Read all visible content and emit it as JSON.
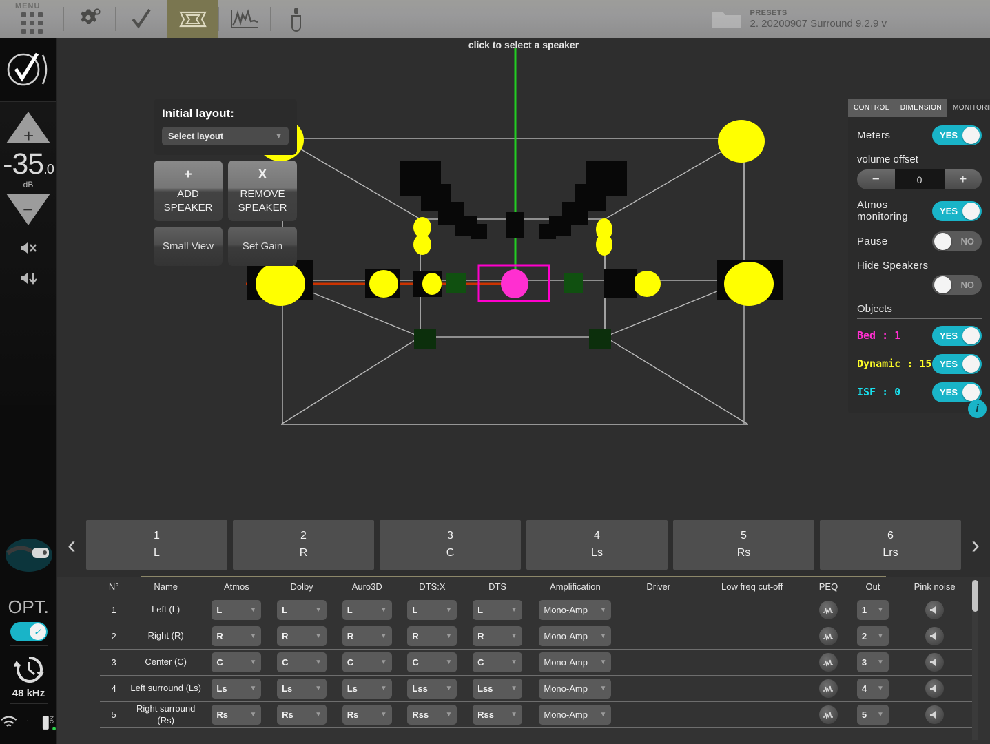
{
  "topbar": {
    "menu_label": "MENU",
    "icons": [
      "grid-menu-icon",
      "gear-icon",
      "check-icon",
      "speaker-layout-icon",
      "waveform-icon",
      "mic-icon"
    ],
    "presets_caption": "PRESETS",
    "presets_value": "2. 20200907 Surround 9.2.9 v"
  },
  "rail": {
    "volume_value": "-35",
    "volume_decimal": ".0",
    "volume_unit": "dB",
    "plus_label": "+",
    "minus_label": "−",
    "source_label": "OPT.",
    "samplerate": "48 kHz",
    "usb_on_label": "ON"
  },
  "stage": {
    "hint": "click to select a speaker"
  },
  "left_panel": {
    "title": "Initial layout:",
    "select_layout": "Select layout",
    "add_symbol": "+",
    "add_line1": "ADD",
    "add_line2": "SPEAKER",
    "remove_symbol": "X",
    "remove_line1": "REMOVE",
    "remove_line2": "SPEAKER",
    "small_view": "Small View",
    "set_gain": "Set Gain"
  },
  "right_panel": {
    "tabs": [
      {
        "label": "CONTROL",
        "selected": true
      },
      {
        "label": "DIMENSION",
        "selected": true
      },
      {
        "label": "MONITORING",
        "selected": false
      }
    ],
    "meters_label": "Meters",
    "meters_value": "YES",
    "volume_offset_label": "volume offset",
    "volume_offset_value": "0",
    "minus": "−",
    "plus": "+",
    "atmos_label_1": "Atmos",
    "atmos_label_2": "monitoring",
    "atmos_value": "YES",
    "pause_label": "Pause",
    "pause_value": "NO",
    "hide_speakers_label": "Hide Speakers",
    "hide_speakers_value": "NO",
    "objects_label": "Objects",
    "objects": [
      {
        "label": "Bed : 1",
        "value": "YES",
        "color": "#ff2fd0"
      },
      {
        "label": "Dynamic : 15",
        "value": "YES",
        "color": "#ffff28"
      },
      {
        "label": "ISF : 0",
        "value": "YES",
        "color": "#19e0ee"
      }
    ],
    "info_label": "i"
  },
  "speaker_tabs": {
    "prev": "‹",
    "next": "›",
    "items": [
      {
        "num": "1",
        "name": "L"
      },
      {
        "num": "2",
        "name": "R"
      },
      {
        "num": "3",
        "name": "C"
      },
      {
        "num": "4",
        "name": "Ls"
      },
      {
        "num": "5",
        "name": "Rs"
      },
      {
        "num": "6",
        "name": "Lrs"
      }
    ]
  },
  "table": {
    "columns": [
      "N°",
      "Name",
      "Atmos",
      "Dolby",
      "Auro3D",
      "DTS:X",
      "DTS",
      "Amplification",
      "Driver",
      "Low freq cut-off",
      "PEQ",
      "Out",
      "Pink noise"
    ],
    "rows": [
      {
        "n": "1",
        "name": "Left (L)",
        "atmos": "L",
        "dolby": "L",
        "auro3d": "L",
        "dtsx": "L",
        "dts": "L",
        "amp": "Mono-Amp",
        "driver": "",
        "lowfreq": "",
        "peq": "peq-icon",
        "out": "1",
        "pink": "speaker-icon"
      },
      {
        "n": "2",
        "name": "Right (R)",
        "atmos": "R",
        "dolby": "R",
        "auro3d": "R",
        "dtsx": "R",
        "dts": "R",
        "amp": "Mono-Amp",
        "driver": "",
        "lowfreq": "",
        "peq": "peq-icon",
        "out": "2",
        "pink": "speaker-icon"
      },
      {
        "n": "3",
        "name": "Center (C)",
        "atmos": "C",
        "dolby": "C",
        "auro3d": "C",
        "dtsx": "C",
        "dts": "C",
        "amp": "Mono-Amp",
        "driver": "",
        "lowfreq": "",
        "peq": "peq-icon",
        "out": "3",
        "pink": "speaker-icon"
      },
      {
        "n": "4",
        "name": "Left surround (Ls)",
        "atmos": "Ls",
        "dolby": "Ls",
        "auro3d": "Ls",
        "dtsx": "Lss",
        "dts": "Lss",
        "amp": "Mono-Amp",
        "driver": "",
        "lowfreq": "",
        "peq": "peq-icon",
        "out": "4",
        "pink": "speaker-icon"
      },
      {
        "n": "5",
        "name": "Right surround (Rs)",
        "atmos": "Rs",
        "dolby": "Rs",
        "auro3d": "Rs",
        "dtsx": "Rss",
        "dts": "Rss",
        "amp": "Mono-Amp",
        "driver": "",
        "lowfreq": "",
        "peq": "peq-icon",
        "out": "5",
        "pink": "speaker-icon"
      }
    ]
  },
  "colors": {
    "accent_cyan": "#19b4c8",
    "active_tab_olive": "#7a7650",
    "speaker_yellow": "#ffff00",
    "selected_magenta": "#ff00cc",
    "axis_green": "#22cc22",
    "axis_red": "#cc3300",
    "object_green": "#105010"
  }
}
